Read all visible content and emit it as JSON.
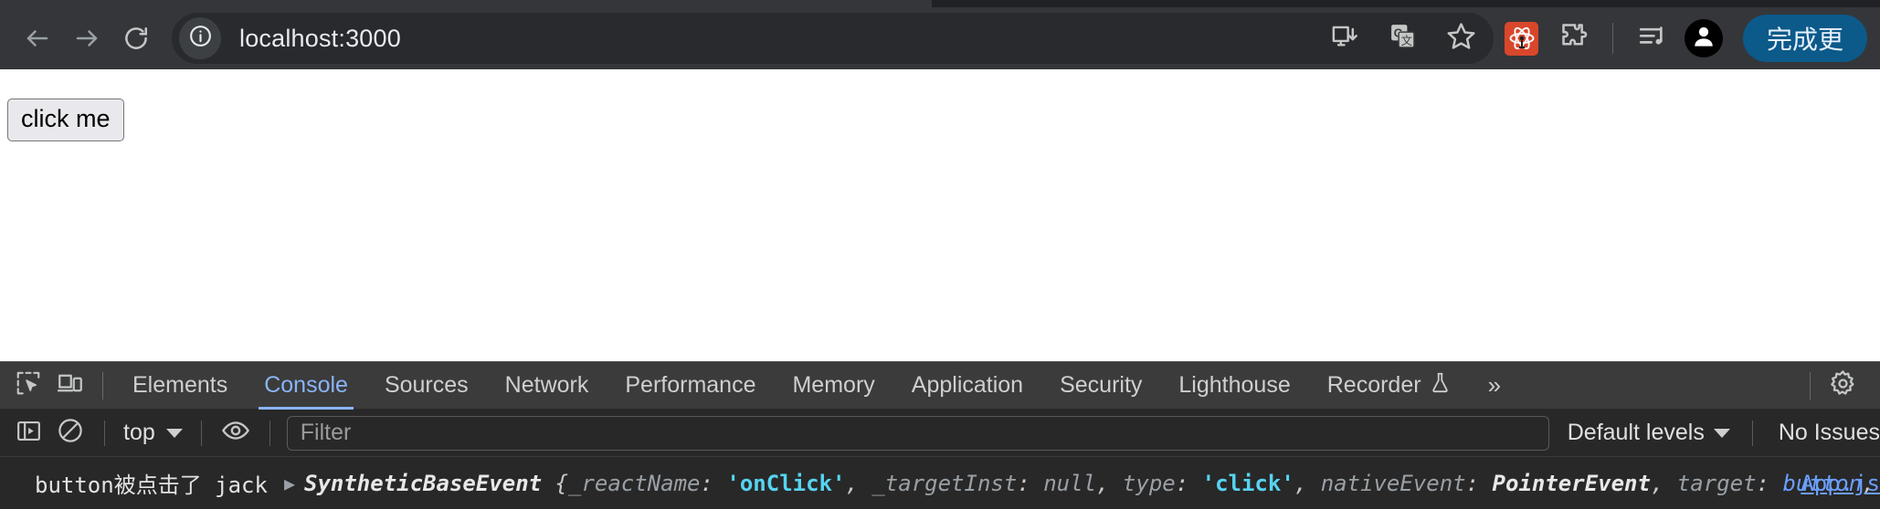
{
  "browser": {
    "back_label": "Back",
    "forward_label": "Forward",
    "reload_label": "Reload",
    "site_info_label": "View site information",
    "url": "localhost:3000",
    "omnibox_icons": [
      "install-app-icon",
      "translate-icon",
      "bookmark-star-icon"
    ],
    "extensions": [
      "react-devtools-icon",
      "extensions-puzzle-icon"
    ],
    "media_control_label": "media-control-icon",
    "avatar_label": "profile-avatar",
    "update_button_label": "完成更"
  },
  "page": {
    "button_label": "click me"
  },
  "devtools": {
    "left_icons": [
      "inspect-element-icon",
      "device-toolbar-icon"
    ],
    "tabs": [
      {
        "label": "Elements",
        "active": false
      },
      {
        "label": "Console",
        "active": true
      },
      {
        "label": "Sources",
        "active": false
      },
      {
        "label": "Network",
        "active": false
      },
      {
        "label": "Performance",
        "active": false
      },
      {
        "label": "Memory",
        "active": false
      },
      {
        "label": "Application",
        "active": false
      },
      {
        "label": "Security",
        "active": false
      },
      {
        "label": "Lighthouse",
        "active": false
      },
      {
        "label": "Recorder",
        "active": false,
        "icon": "experiment-flask-icon"
      }
    ],
    "more_tabs_label": "»",
    "settings_label": "settings-gear-icon",
    "console_toolbar": {
      "sidebar_toggle_label": "show-console-sidebar-icon",
      "clear_label": "clear-console-icon",
      "context": "top",
      "eye_label": "live-expression-icon",
      "filter_placeholder": "Filter",
      "filter_value": "",
      "levels_label": "Default levels",
      "issues_label": "No Issues"
    },
    "console_log": {
      "message": "button被点击了 jack",
      "expand_arrow": "▶",
      "object_name": "SyntheticBaseEvent",
      "open_brace": "{",
      "entries": [
        {
          "key": "_reactName",
          "value": "'onClick'",
          "kind": "string"
        },
        {
          "key": "_targetInst",
          "value": "null",
          "kind": "null"
        },
        {
          "key": "type",
          "value": "'click'",
          "kind": "string"
        },
        {
          "key": "nativeEvent",
          "value": "PointerEvent",
          "kind": "ctor"
        },
        {
          "key": "target",
          "value": "button",
          "kind": "node"
        }
      ],
      "ellipsis": "…",
      "close_brace": "}",
      "source": "App.js"
    }
  },
  "colors": {
    "chrome_bg": "#35363a",
    "omnibox_bg": "#292a2d",
    "accent_blue": "#8ab4f8",
    "update_button": "#0b5a8a",
    "devtools_bg": "#282828",
    "devtools_tabbar": "#3b3b3b",
    "string_cyan": "#56d4f0",
    "link_blue": "#6b9fff"
  }
}
